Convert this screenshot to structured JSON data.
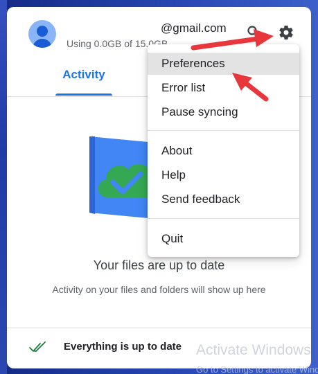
{
  "account": {
    "email": "@gmail.com",
    "storage": "Using 0.0GB of 15.0GB"
  },
  "icons": {
    "avatar": "account-avatar-icon",
    "search": "search-icon",
    "settings": "gear-icon",
    "sync": "double-check-icon"
  },
  "tabs": [
    {
      "label": "Activity",
      "active": true
    }
  ],
  "status": {
    "title": "Your files are up to date",
    "subtitle": "Activity on your files and folders will show up here"
  },
  "footer": {
    "sync_text": "Everything is up to date"
  },
  "menu": {
    "items": [
      {
        "label": "Preferences",
        "highlighted": true
      },
      {
        "label": "Error list"
      },
      {
        "label": "Pause syncing"
      },
      {
        "label": "About"
      },
      {
        "label": "Help"
      },
      {
        "label": "Send feedback"
      },
      {
        "label": "Quit"
      }
    ]
  },
  "watermark": {
    "title": "Activate Windows",
    "subtitle": "Go to Settings to activate Windows."
  },
  "colors": {
    "accent": "#1a73e8",
    "annotation_arrow": "#e8373c",
    "cloud_green": "#34a853",
    "folder_blue": "#4285f4"
  }
}
